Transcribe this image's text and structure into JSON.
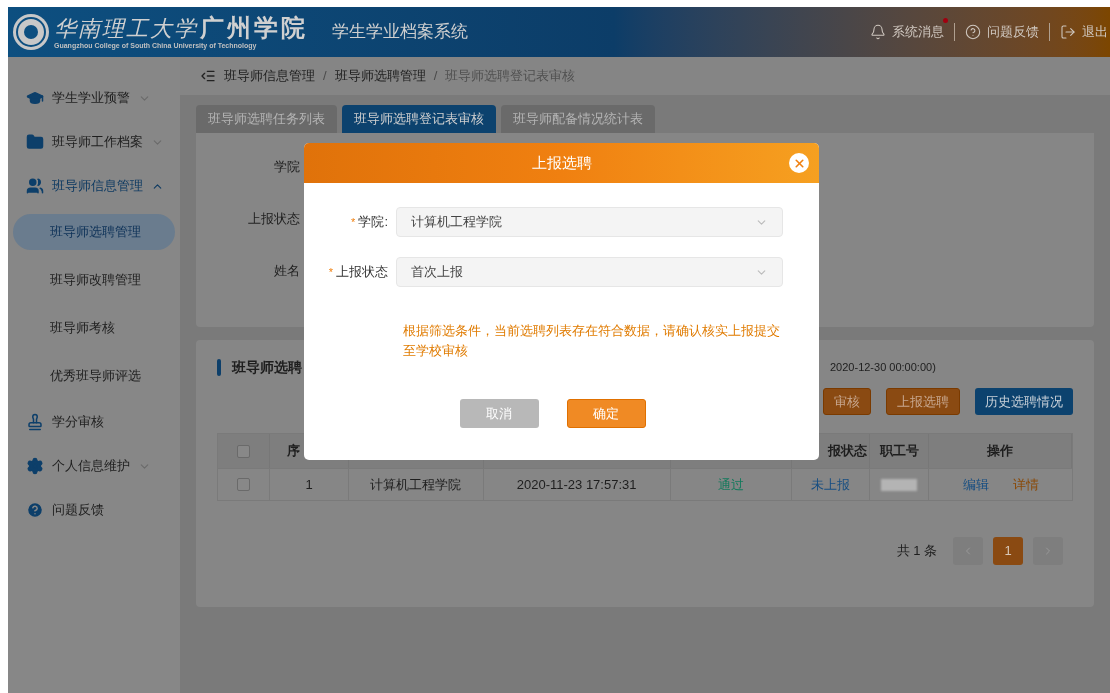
{
  "header": {
    "logo_script": "华南理工大学",
    "logo_name": "广州学院",
    "logo_subtitle": "Guangzhou College of South China University of Technology",
    "system_title": "学生学业档案系统",
    "actions": [
      {
        "kind": "bell",
        "label": "系统消息",
        "unread": true
      },
      {
        "kind": "help",
        "label": "问题反馈",
        "unread": false
      },
      {
        "kind": "logout",
        "label": "退出",
        "unread": false
      }
    ]
  },
  "sidebar": {
    "items": [
      {
        "label": "学生学业预警",
        "expandable": true,
        "expanded": false
      },
      {
        "label": "班导师工作档案",
        "expandable": true,
        "expanded": false
      },
      {
        "label": "班导师信息管理",
        "expandable": true,
        "expanded": true,
        "children": [
          {
            "label": "班导师选聘管理",
            "selected": true
          },
          {
            "label": "班导师改聘管理",
            "selected": false
          },
          {
            "label": "班导师考核",
            "selected": false
          },
          {
            "label": "优秀班导师评选",
            "selected": false
          }
        ]
      },
      {
        "label": "学分审核",
        "expandable": false,
        "expanded": false
      },
      {
        "label": "个人信息维护",
        "expandable": true,
        "expanded": false
      },
      {
        "label": "问题反馈",
        "expandable": false,
        "expanded": false
      }
    ]
  },
  "breadcrumb": [
    {
      "label": "班导师信息管理"
    },
    {
      "separator": "/",
      "label": "班导师选聘管理"
    },
    {
      "separator": "/",
      "label": "班导师选聘登记表审核"
    }
  ],
  "tabs": [
    {
      "label": "班导师选聘任务列表",
      "selected": false
    },
    {
      "label": "班导师选聘登记表审核",
      "selected": true
    },
    {
      "label": "班导师配备情况统计表",
      "selected": false
    }
  ],
  "filters": [
    "学院",
    "上报状态",
    "姓名"
  ],
  "list": {
    "title": "班导师选聘",
    "note": "2020-12-30 00:00:00)",
    "buttons": [
      {
        "label": "审核",
        "kind": "orange"
      },
      {
        "label": "上报选聘",
        "kind": "orange"
      },
      {
        "label": "历史选聘情况",
        "kind": "blue"
      }
    ],
    "columns": [
      {
        "kind": "checkbox",
        "checked": false
      },
      {
        "kind": "text",
        "label": "序"
      },
      {
        "kind": "covered"
      },
      {
        "kind": "covered"
      },
      {
        "kind": "covered"
      },
      {
        "kind": "text",
        "label": "报状态"
      },
      {
        "kind": "text",
        "label": "职工号"
      },
      {
        "kind": "text",
        "label": "操作"
      }
    ],
    "rows": [
      {
        "checked": false,
        "index": "1",
        "college": "计算机工程学院",
        "time": "2020-11-23 17:57:31",
        "review": {
          "text": "通过",
          "color": "#137a5c"
        },
        "report": {
          "text": "未上报",
          "color": "#174e82"
        },
        "actions": [
          {
            "label": "编辑",
            "color": "#174e82"
          },
          {
            "label": "详情",
            "color": "#8a4a08"
          }
        ]
      }
    ]
  },
  "pagination": {
    "total": "共 1 条",
    "pages": [
      {
        "label": "1",
        "selected": true
      }
    ]
  },
  "modal": {
    "title": "上报选聘",
    "fields": [
      {
        "mark": "*",
        "label": "学院:",
        "value": "计算机工程学院"
      },
      {
        "mark": "*",
        "label": "上报状态",
        "value": "首次上报"
      }
    ],
    "message": "根据筛选条件，当前选聘列表存在符合数据，请确认核实上报提交至学校审核",
    "buttons": [
      {
        "label": "取消",
        "kind": "secondary"
      },
      {
        "label": "确定",
        "kind": "primary"
      }
    ]
  }
}
